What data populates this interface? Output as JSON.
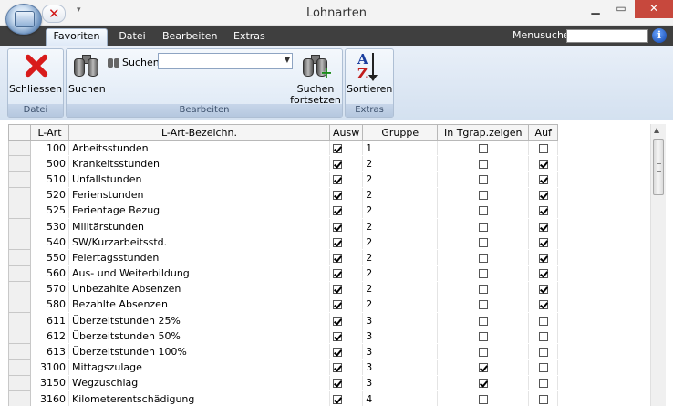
{
  "window": {
    "title": "Lohnarten",
    "minimize": "▁",
    "maximize": "▭",
    "close": "✕"
  },
  "ribbon": {
    "tabs": [
      "Favoriten",
      "Datei",
      "Bearbeiten",
      "Extras"
    ],
    "menusuche_label": "Menusuche",
    "menusuche_value": "",
    "help": "i",
    "groups": {
      "datei": {
        "label": "Datei",
        "close_label": "Schliessen"
      },
      "bearbeiten": {
        "label": "Bearbeiten",
        "search_label": "Suchen",
        "search_button": "Suchen",
        "search_value": "",
        "continue_line1": "Suchen",
        "continue_line2": "fortsetzen"
      },
      "extras": {
        "label": "Extras",
        "sort_label": "Sortieren"
      }
    }
  },
  "table": {
    "columns": [
      "L-Art",
      "L-Art-Bezeichn.",
      "Ausw",
      "Gruppe",
      "In Tgrap.zeigen",
      "Auf"
    ],
    "rows": [
      {
        "lart": "100",
        "bez": "Arbeitsstunden",
        "ausw": true,
        "gruppe": "1",
        "tg": false,
        "auf": false
      },
      {
        "lart": "500",
        "bez": "Krankeitsstunden",
        "ausw": true,
        "gruppe": "2",
        "tg": false,
        "auf": true
      },
      {
        "lart": "510",
        "bez": "Unfallstunden",
        "ausw": true,
        "gruppe": "2",
        "tg": false,
        "auf": true
      },
      {
        "lart": "520",
        "bez": "Ferienstunden",
        "ausw": true,
        "gruppe": "2",
        "tg": false,
        "auf": true
      },
      {
        "lart": "525",
        "bez": "Ferientage Bezug",
        "ausw": true,
        "gruppe": "2",
        "tg": false,
        "auf": true
      },
      {
        "lart": "530",
        "bez": "Militärstunden",
        "ausw": true,
        "gruppe": "2",
        "tg": false,
        "auf": true
      },
      {
        "lart": "540",
        "bez": "SW/Kurzarbeitsstd.",
        "ausw": true,
        "gruppe": "2",
        "tg": false,
        "auf": true
      },
      {
        "lart": "550",
        "bez": "Feiertagsstunden",
        "ausw": true,
        "gruppe": "2",
        "tg": false,
        "auf": true
      },
      {
        "lart": "560",
        "bez": "Aus- und Weiterbildung",
        "ausw": true,
        "gruppe": "2",
        "tg": false,
        "auf": true
      },
      {
        "lart": "570",
        "bez": "Unbezahlte Absenzen",
        "ausw": true,
        "gruppe": "2",
        "tg": false,
        "auf": true
      },
      {
        "lart": "580",
        "bez": "Bezahlte Absenzen",
        "ausw": true,
        "gruppe": "2",
        "tg": false,
        "auf": true
      },
      {
        "lart": "611",
        "bez": "Überzeitstunden 25%",
        "ausw": true,
        "gruppe": "3",
        "tg": false,
        "auf": false
      },
      {
        "lart": "612",
        "bez": "Überzeitstunden 50%",
        "ausw": true,
        "gruppe": "3",
        "tg": false,
        "auf": false
      },
      {
        "lart": "613",
        "bez": "Überzeitstunden 100%",
        "ausw": true,
        "gruppe": "3",
        "tg": false,
        "auf": false
      },
      {
        "lart": "3100",
        "bez": "Mittagszulage",
        "ausw": true,
        "gruppe": "3",
        "tg": true,
        "auf": false
      },
      {
        "lart": "3150",
        "bez": "Wegzuschlag",
        "ausw": true,
        "gruppe": "3",
        "tg": true,
        "auf": false
      },
      {
        "lart": "3160",
        "bez": "Kilometerentschädigung",
        "ausw": true,
        "gruppe": "4",
        "tg": false,
        "auf": false
      }
    ]
  }
}
